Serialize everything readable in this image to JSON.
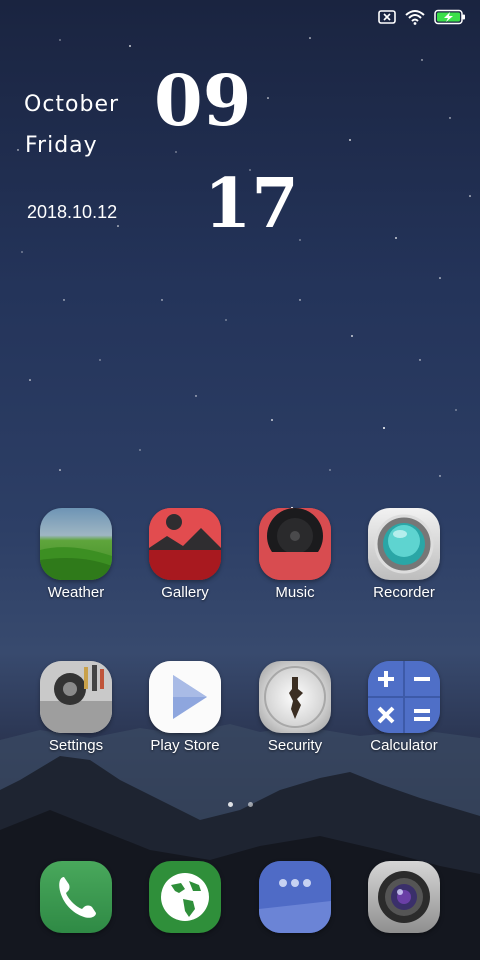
{
  "status_bar": {
    "icons": [
      "sim-none-icon",
      "wifi-icon",
      "battery-charging-icon"
    ]
  },
  "clock_widget": {
    "month": "October",
    "weekday": "Friday",
    "date": "2018.10.12",
    "hour": "09",
    "minute": "17"
  },
  "apps_row1": [
    {
      "label": "Weather",
      "icon": "weather-icon"
    },
    {
      "label": "Gallery",
      "icon": "gallery-icon"
    },
    {
      "label": "Music",
      "icon": "music-icon"
    },
    {
      "label": "Recorder",
      "icon": "recorder-icon"
    }
  ],
  "apps_row2": [
    {
      "label": "Settings",
      "icon": "settings-icon"
    },
    {
      "label": "Play Store",
      "icon": "play-store-icon"
    },
    {
      "label": "Security",
      "icon": "security-icon"
    },
    {
      "label": "Calculator",
      "icon": "calculator-icon"
    }
  ],
  "page_indicator": {
    "pages": 2,
    "current": 1
  },
  "dock": [
    {
      "icon": "phone-icon"
    },
    {
      "icon": "browser-icon"
    },
    {
      "icon": "messages-icon"
    },
    {
      "icon": "camera-icon"
    }
  ],
  "colors": {
    "battery_accent": "#3be04a",
    "sky_top": "#1a2440",
    "sky_mid": "#2d3f66"
  }
}
